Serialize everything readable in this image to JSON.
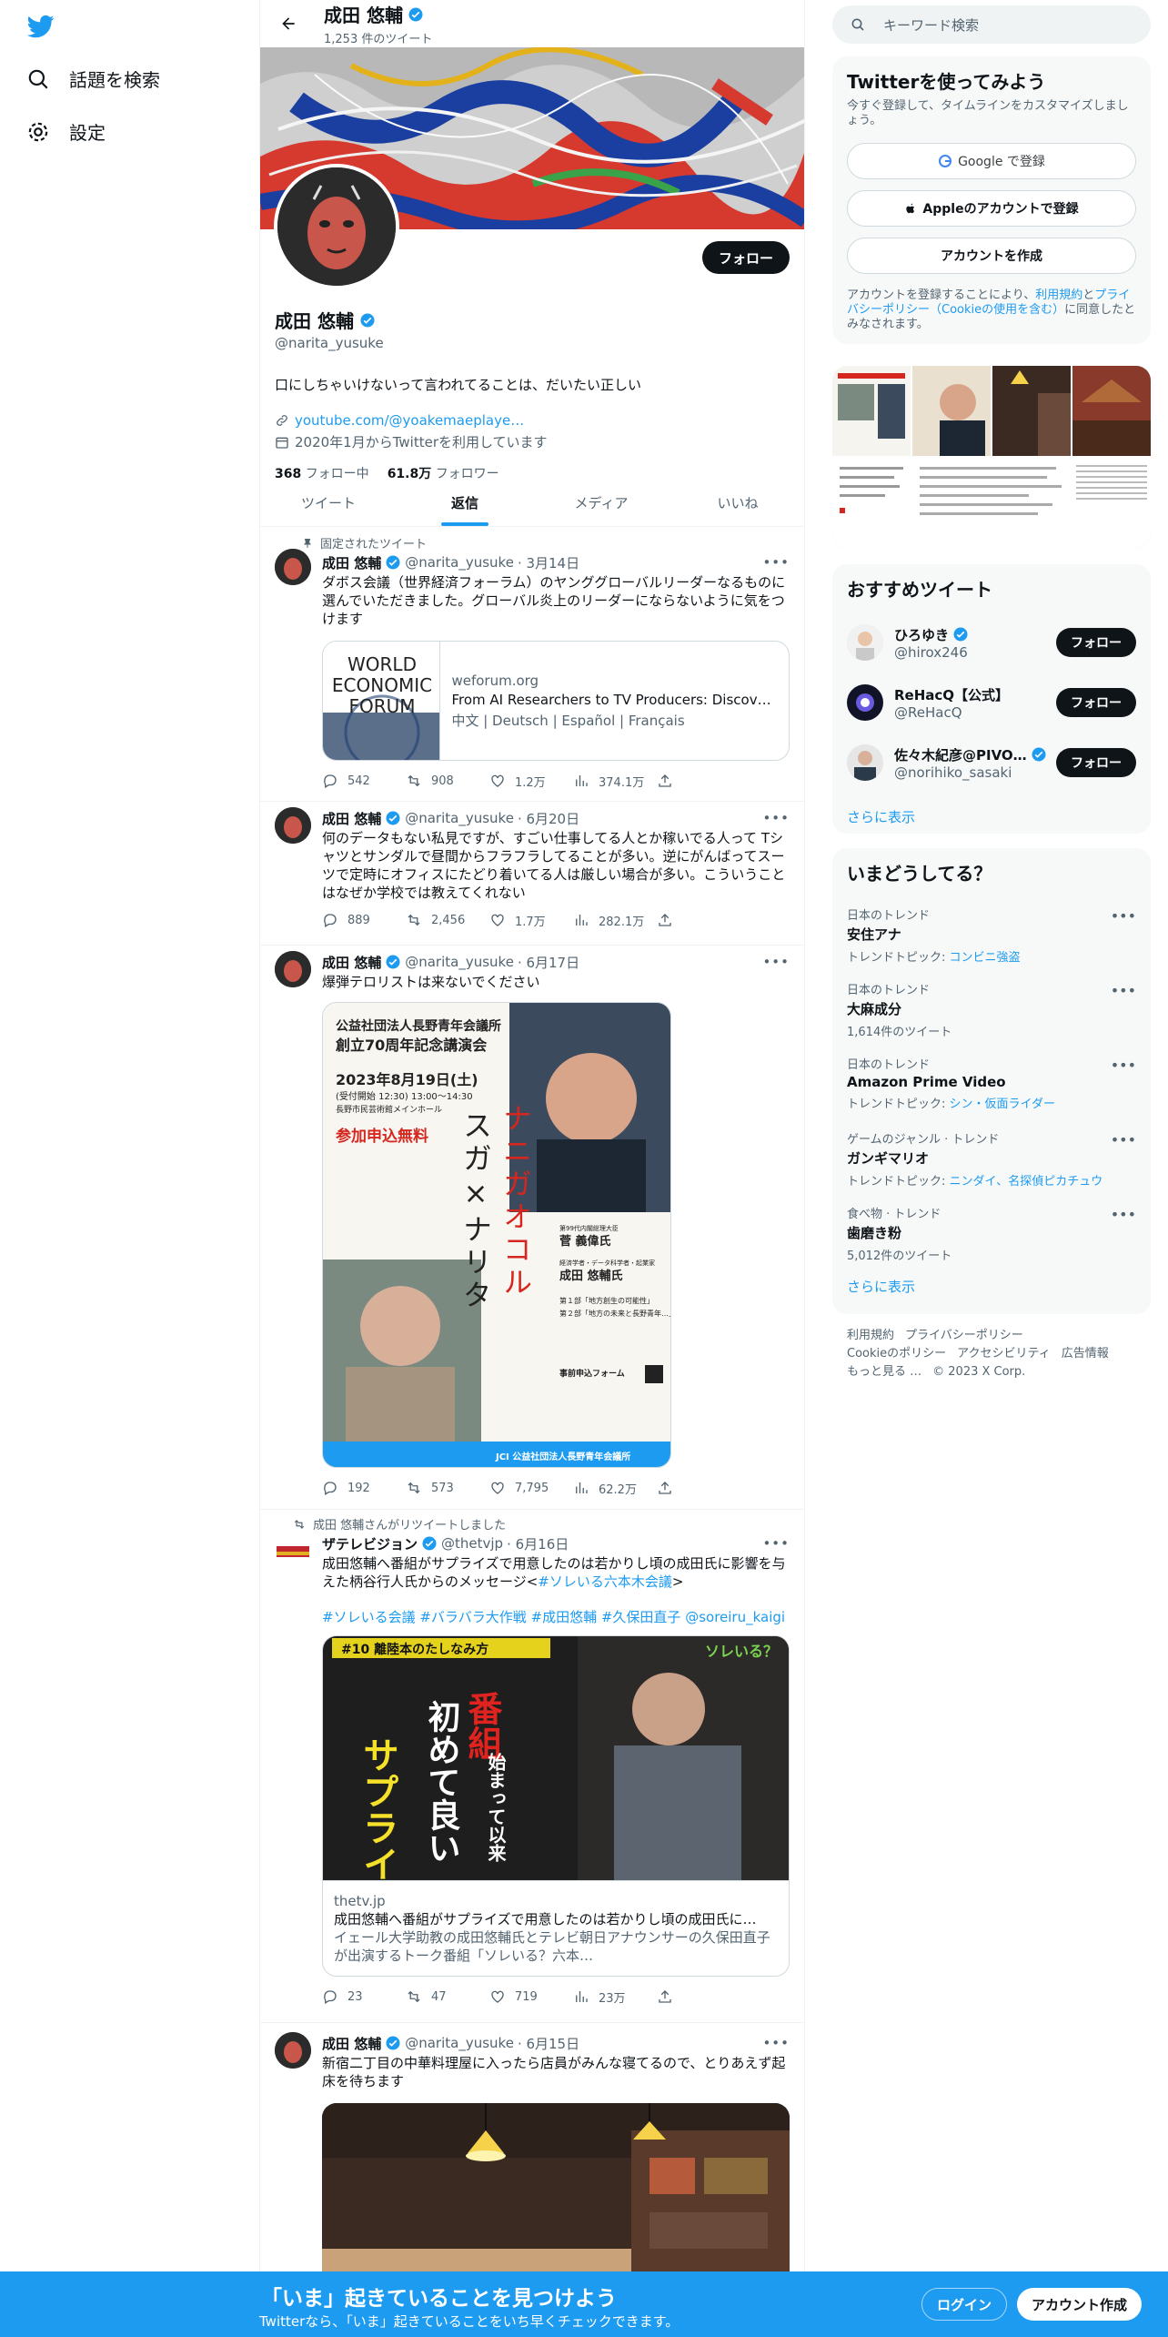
{
  "nav": {
    "explore_label": "話題を検索",
    "settings_label": "設定"
  },
  "header": {
    "name": "成田 悠輔",
    "tweet_count": "1,253 件のツイート"
  },
  "profile": {
    "name": "成田 悠輔",
    "handle": "@narita_yusuke",
    "follow_label": "フォロー",
    "bio": "口にしちゃいけないって言われてることは、だいたい正しい",
    "link": "youtube.com/@yoakemaeplaye…",
    "joined": "2020年1月からTwitterを利用しています",
    "following_count": "368",
    "following_label": "フォロー中",
    "followers_count": "61.8万",
    "followers_label": "フォロワー"
  },
  "tabs": [
    "ツイート",
    "返信",
    "メディア",
    "いいね"
  ],
  "tweets": [
    {
      "context": "固定されたツイート",
      "name": "成田 悠輔",
      "handle": "@narita_yusuke",
      "date": "· 3月14日",
      "text": "ダボス会議（世界経済フォーラム）のヤンググローバルリーダーなるものに選んでいただきました。グローバル炎上のリーダーにならないように気をつけます",
      "card": {
        "domain": "weforum.org",
        "title": "From AI Researchers to TV Producers: Discover th…",
        "desc": "中文 | Deutsch | Español | Français",
        "logo_line1": "WORLD",
        "logo_line2": "ECONOMIC",
        "logo_line3": "FORUM"
      },
      "replies": "542",
      "retweets": "908",
      "likes": "1.2万",
      "views": "374.1万"
    },
    {
      "name": "成田 悠輔",
      "handle": "@narita_yusuke",
      "date": "· 6月20日",
      "text": "何のデータもない私見ですが、すごい仕事してる人とか稼いでる人って Tシャツとサンダルで昼間からフラフラしてることが多い。逆にがんばってスーツで定時にオフィスにたどり着いてる人は厳しい場合が多い。こういうことはなぜか学校では教えてくれない",
      "replies": "889",
      "retweets": "2,456",
      "likes": "1.7万",
      "views": "282.1万"
    },
    {
      "name": "成田 悠輔",
      "handle": "@narita_yusuke",
      "date": "· 6月17日",
      "text": "爆弾テロリストは来ないでください",
      "poster": {
        "org": "公益社団法人長野青年会議所",
        "event": "創立70周年記念講演会",
        "date": "2023年8月19日(土)",
        "time": "(受付開始 12:30) 13:00〜14:30",
        "venue": "長野市民芸術館メインホール",
        "free": "参加申込無料",
        "title_v": "スガ×ナリタ",
        "title_r": "ナニガオコル",
        "speaker1_role": "第99代内閣総理大臣",
        "speaker1": "菅 義偉氏",
        "speaker2_role": "経済学者・データ科学者・起業家",
        "speaker2": "成田 悠輔氏",
        "part1": "第１部「地方創生の可能性」",
        "part2": "第２部「地方の未来と長野青年…」",
        "form": "事前申込フォーム",
        "footer": "JCI 公益社団法人長野青年会議所"
      },
      "replies": "192",
      "retweets": "573",
      "likes": "7,795",
      "views": "62.2万"
    },
    {
      "context": "成田 悠輔さんがリツイートしました",
      "name": "ザテレビジョン",
      "handle": "@thetvjp",
      "date": "· 6月16日",
      "text": "成田悠輔へ番組がサプライズで用意したのは若かりし頃の成田氏に影響を与えた柄谷行人氏からのメッセージ<",
      "link": "#ソレいる六本木会議",
      "text_end": ">",
      "hashtags": "#ソレいる会議 #バラバラ大作戦 #成田悠輔 #久保田直子 @soreiru_kaigi",
      "card": {
        "domain": "thetv.jp",
        "title": "成田悠輔へ番組がサプライズで用意したのは若かりし頃の成田氏に…",
        "desc": "イェール大学助教の成田悠輔氏とテレビ朝日アナウンサーの久保田直子が出演するトーク番組「ソレいる？六本…",
        "img_tag": "#10 離陸本のたしなみ方",
        "img_logo": "ソレいる？",
        "img_red": "番組",
        "img_white1": "始まって以来",
        "img_white2": "初めて良い",
        "img_yellow": "サプライズ"
      },
      "replies": "23",
      "retweets": "47",
      "likes": "719",
      "views": "23万"
    },
    {
      "name": "成田 悠輔",
      "handle": "@narita_yusuke",
      "date": "· 6月15日",
      "text": "新宿二丁目の中華料理屋に入ったら店員がみんな寝てるので、とりあえず起床を待ちます"
    }
  ],
  "sidebar": {
    "search_placeholder": "キーワード検索",
    "join_title": "Twitterを使ってみよう",
    "join_desc": "今すぐ登録して、タイムラインをカスタマイズしましょう。",
    "google_btn": "Google で登録",
    "apple_btn": "Appleのアカウントで登録",
    "create_btn": "アカウントを作成",
    "legal_pre": "アカウントを登録することにより、",
    "legal_terms": "利用規約",
    "legal_and": "と",
    "legal_privacy": "プライバシーポリシー",
    "legal_cookie": "（Cookieの使用を含む）",
    "legal_post": "に同意したとみなされます。",
    "rec_title": "おすすめツイート",
    "recs": [
      {
        "name": "ひろゆき",
        "handle": "@hirox246",
        "btn": "フォロー"
      },
      {
        "name": "ReHacQ【公式】",
        "handle": "@ReHacQ",
        "btn": "フォロー"
      },
      {
        "name": "佐々木紀彦@PIVO…",
        "handle": "@norihiko_sasaki",
        "btn": "フォロー"
      }
    ],
    "show_more": "さらに表示",
    "trends_title": "いまどうしてる？",
    "trends": [
      {
        "cat": "日本のトレンド",
        "title": "安住アナ",
        "sub_pre": "トレンドトピック: ",
        "sub_link": "コンビニ強盗"
      },
      {
        "cat": "日本のトレンド",
        "title": "大麻成分",
        "sub_pre": "1,614件のツイート",
        "sub_link": ""
      },
      {
        "cat": "日本のトレンド",
        "title": "Amazon Prime Video",
        "sub_pre": "トレンドトピック: ",
        "sub_link": "シン・仮面ライダー"
      },
      {
        "cat": "ゲームのジャンル · トレンド",
        "title": "ガンギマリオ",
        "sub_pre": "トレンドトピック: ",
        "sub_link": "ニンダイ、名探偵ピカチュウ"
      },
      {
        "cat": "食べ物 · トレンド",
        "title": "歯磨き粉",
        "sub_pre": "5,012件のツイート",
        "sub_link": ""
      }
    ],
    "footer": [
      "利用規約",
      "プライバシーポリシー",
      "Cookieのポリシー",
      "アクセシビリティ",
      "広告情報",
      "もっと見る …",
      "© 2023 X Corp."
    ]
  },
  "bottom": {
    "title": "「いま」起きていることを見つけよう",
    "subtitle": "Twitterなら、「いま」起きていることをいち早くチェックできます。",
    "login": "ログイン",
    "signup": "アカウント作成"
  },
  "colors": {
    "accent": "#1d9bf0",
    "text": "#0f1419",
    "muted": "#536471",
    "border": "#eff3f4"
  }
}
